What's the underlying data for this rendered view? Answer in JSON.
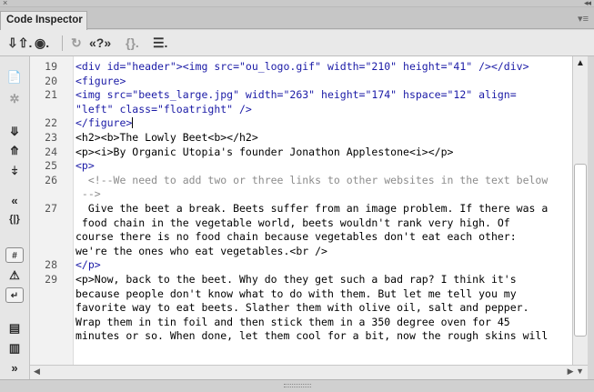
{
  "window": {
    "close_glyph": "×",
    "collapse_glyph": "◂◂",
    "tab_title": "Code Inspector",
    "panel_menu_glyph": "▾≡"
  },
  "toolbar": {
    "file_management_icon": "⇩⇧.",
    "preview_icon": "◉.",
    "refresh_icon": "↻",
    "code_navigation_icon": "«?»",
    "braces_icon": "{}.",
    "options_icon": "☰."
  },
  "gutter_icons": [
    {
      "name": "open-documents-icon",
      "glyph": "📄"
    },
    {
      "name": "show-code-navigator-icon",
      "glyph": "✲"
    },
    {
      "name": "collapse-full-tag-icon",
      "glyph": "⤋"
    },
    {
      "name": "collapse-selection-icon",
      "glyph": "⤊"
    },
    {
      "name": "expand-all-icon",
      "glyph": "⤈"
    },
    {
      "name": "select-parent-tag-icon",
      "glyph": "«"
    },
    {
      "name": "balance-braces-icon",
      "glyph": "{|}"
    },
    {
      "name": "line-numbers-icon",
      "glyph": "#"
    },
    {
      "name": "highlight-invalid-code-icon",
      "glyph": "⚠"
    },
    {
      "name": "word-wrap-icon",
      "glyph": "↵"
    },
    {
      "name": "apply-comment-icon",
      "glyph": "▤"
    },
    {
      "name": "remove-comment-icon",
      "glyph": "▥"
    },
    {
      "name": "more-icon",
      "glyph": "»"
    }
  ],
  "code": {
    "lines": [
      {
        "num": "19",
        "text": "<div id=\"header\"><img src=\"ou_logo.gif\" width=\"210\" height=\"41\" /></div>",
        "kind": "tag"
      },
      {
        "num": "20",
        "text": "<figure>",
        "kind": "tag"
      },
      {
        "num": "21",
        "text": "<img src=\"beets_large.jpg\" width=\"263\" height=\"174\" hspace=\"12\" align=",
        "kind": "tag"
      },
      {
        "num": "",
        "text": "\"left\" class=\"floatright\" />",
        "kind": "tag"
      },
      {
        "num": "22",
        "text": "</figure>",
        "kind": "tag",
        "cursor": true
      },
      {
        "num": "23",
        "text": "<h2><b>The Lowly Beet<b></h2>",
        "kind": "text"
      },
      {
        "num": "24",
        "text": "<p><i>By Organic Utopia's founder Jonathon Applestone<i></p>",
        "kind": "text"
      },
      {
        "num": "25",
        "text": "<p>",
        "kind": "tag"
      },
      {
        "num": "26",
        "text": "  <!--We need to add two or three links to other websites in the text below",
        "kind": "comment"
      },
      {
        "num": "",
        "text": " -->",
        "kind": "comment"
      },
      {
        "num": "27",
        "text": "  Give the beet a break. Beets suffer from an image problem. If there was a",
        "kind": "text"
      },
      {
        "num": "",
        "text": " food chain in the vegetable world, beets wouldn't rank very high. Of",
        "kind": "text"
      },
      {
        "num": "",
        "text": "course there is no food chain because vegetables don't eat each other:",
        "kind": "text"
      },
      {
        "num": "",
        "text": "we're the ones who eat vegetables.<br />",
        "kind": "text"
      },
      {
        "num": "28",
        "text": "</p>",
        "kind": "tag"
      },
      {
        "num": "29",
        "text": "<p>Now, back to the beet. Why do they get such a bad rap? I think it's",
        "kind": "text"
      },
      {
        "num": "",
        "text": "because people don't know what to do with them. But let me tell you my",
        "kind": "text"
      },
      {
        "num": "",
        "text": "favorite way to eat beets. Slather them with olive oil, salt and pepper.",
        "kind": "text"
      },
      {
        "num": "",
        "text": "Wrap them in tin foil and then stick them in a 350 degree oven for 45",
        "kind": "text"
      },
      {
        "num": "",
        "text": "minutes or so. When done, let them cool for a bit, now the rough skins will",
        "kind": "text"
      }
    ]
  },
  "scrollbars": {
    "up_arrow": "▲",
    "down_arrow": "▼",
    "left_arrow": "◀",
    "right_arrow": "▶ ▼"
  },
  "colors": {
    "tag": "#1a1aa6",
    "comment": "#8c8c8c",
    "text": "#000000"
  }
}
